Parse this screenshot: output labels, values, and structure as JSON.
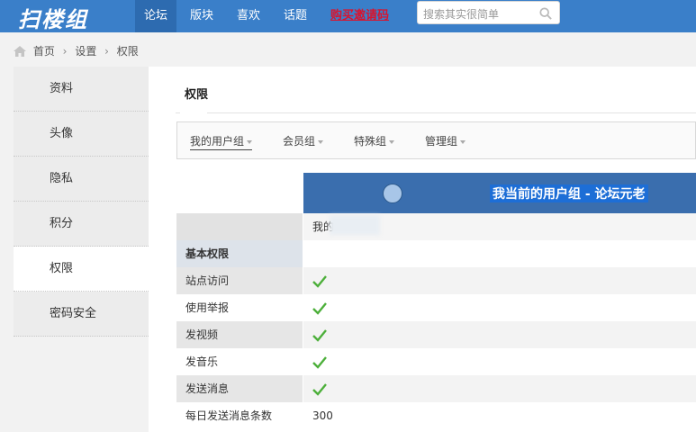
{
  "header": {
    "logo": "扫楼组",
    "nav": [
      "论坛",
      "版块",
      "喜欢",
      "话题"
    ],
    "buy_link": "购买邀请码",
    "search_placeholder": "搜索其实很简单"
  },
  "breadcrumb": [
    "首页",
    "设置",
    "权限"
  ],
  "sidebar": {
    "items": [
      "资料",
      "头像",
      "隐私",
      "积分",
      "权限",
      "密码安全"
    ],
    "active": "权限"
  },
  "main": {
    "title": "权限",
    "tabs": [
      "我的用户组",
      "会员组",
      "特殊组",
      "管理组"
    ],
    "banner_text": "我当前的用户组 - 论坛元老",
    "column_label": "我的",
    "section_header": "基本权限",
    "rows": [
      {
        "label": "站点访问",
        "value": "check"
      },
      {
        "label": "使用举报",
        "value": "check"
      },
      {
        "label": "发视频",
        "value": "check"
      },
      {
        "label": "发音乐",
        "value": "check"
      },
      {
        "label": "发送消息",
        "value": "check"
      },
      {
        "label": "每日发送消息条数",
        "value": "300"
      }
    ]
  },
  "colors": {
    "topbar": "#3a7fc9",
    "nav_active": "#2d6bb0",
    "buy_link": "#d8142f",
    "banner": "#3a6eae",
    "check": "#4caf3a"
  }
}
